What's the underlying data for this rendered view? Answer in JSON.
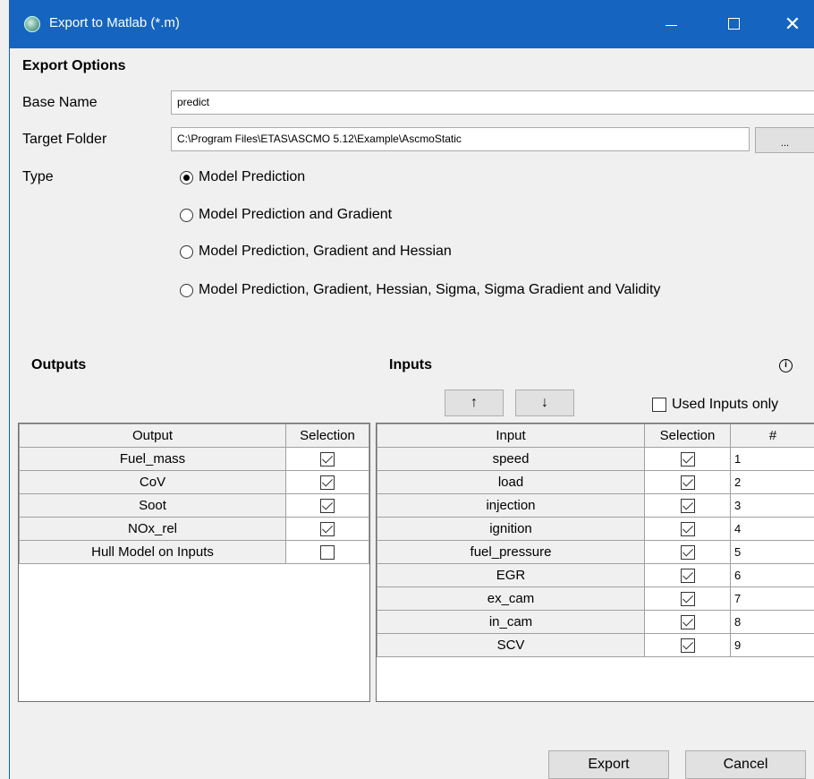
{
  "window": {
    "title": "Export to Matlab (*.m)",
    "controls": {
      "minimize": "—",
      "maximize": "☐",
      "close": "✕"
    }
  },
  "export_options": {
    "heading": "Export Options",
    "base_name": {
      "label": "Base Name",
      "value": "predict"
    },
    "target_folder": {
      "label": "Target Folder",
      "value": "C:\\Program Files\\ETAS\\ASCMO 5.12\\Example\\AscmoStatic",
      "browse_label": "..."
    },
    "type": {
      "label": "Type",
      "options": [
        {
          "label": "Model Prediction",
          "selected": true
        },
        {
          "label": "Model Prediction and Gradient",
          "selected": false
        },
        {
          "label": "Model Prediction, Gradient and Hessian",
          "selected": false
        },
        {
          "label": "Model Prediction, Gradient, Hessian, Sigma, Sigma Gradient and Validity",
          "selected": false
        }
      ]
    }
  },
  "outputs": {
    "heading": "Outputs",
    "columns": [
      "Output",
      "Selection"
    ],
    "rows": [
      {
        "name": "Fuel_mass",
        "selected": true
      },
      {
        "name": "CoV",
        "selected": true
      },
      {
        "name": "Soot",
        "selected": true
      },
      {
        "name": "NOx_rel",
        "selected": true
      },
      {
        "name": "Hull Model on Inputs",
        "selected": false
      }
    ]
  },
  "inputs": {
    "heading": "Inputs",
    "info_icon": "i",
    "move_up_label": "↑",
    "move_down_label": "↓",
    "used_inputs_only": {
      "label": "Used Inputs only",
      "checked": false
    },
    "columns": [
      "Input",
      "Selection",
      "#"
    ],
    "rows": [
      {
        "name": "speed",
        "selected": true,
        "index": "1"
      },
      {
        "name": "load",
        "selected": true,
        "index": "2"
      },
      {
        "name": "injection",
        "selected": true,
        "index": "3"
      },
      {
        "name": "ignition",
        "selected": true,
        "index": "4"
      },
      {
        "name": "fuel_pressure",
        "selected": true,
        "index": "5"
      },
      {
        "name": "EGR",
        "selected": true,
        "index": "6"
      },
      {
        "name": "ex_cam",
        "selected": true,
        "index": "7"
      },
      {
        "name": "in_cam",
        "selected": true,
        "index": "8"
      },
      {
        "name": "SCV",
        "selected": true,
        "index": "9"
      }
    ]
  },
  "footer": {
    "export_label": "Export",
    "cancel_label": "Cancel"
  }
}
